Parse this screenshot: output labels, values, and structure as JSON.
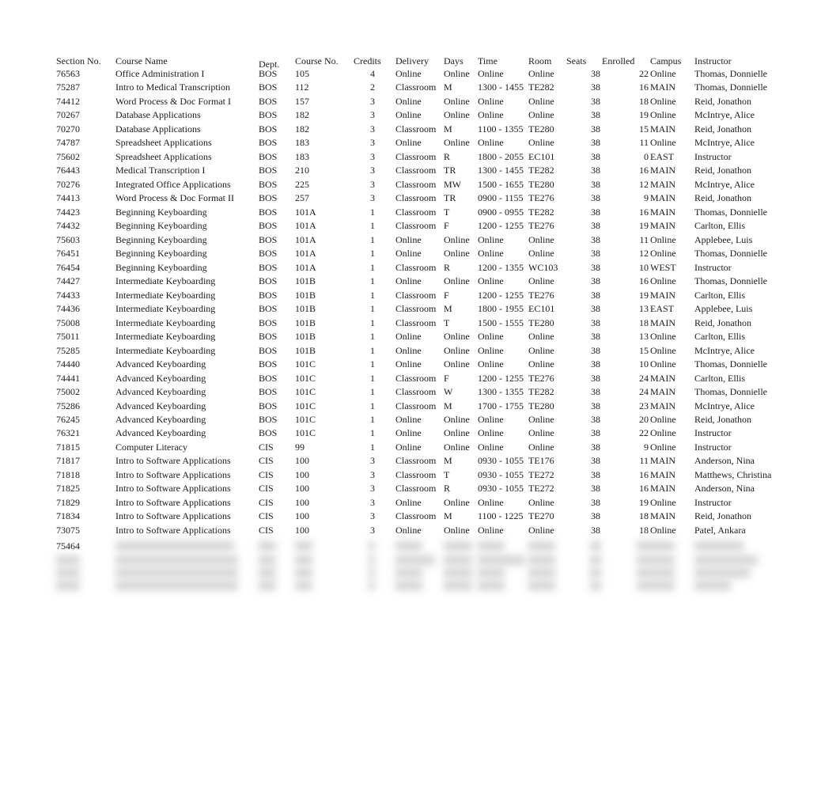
{
  "headers": {
    "section": "Section No.",
    "name": "Course Name",
    "dept": "Dept.",
    "course_no": "Course No.",
    "credits": "Credits",
    "delivery": "Delivery",
    "days": "Days",
    "time": "Time",
    "room": "Room",
    "seats": "Seats",
    "enrolled": "Enrolled",
    "campus": "Campus",
    "instructor": "Instructor"
  },
  "rows": [
    {
      "section": "76563",
      "name": "Office Administration I",
      "dept": "BOS",
      "course_no": "105",
      "credits": "4",
      "delivery": "Online",
      "days": "Online",
      "time": "Online",
      "room": "Online",
      "seats": "38",
      "enrolled": "22",
      "campus": "Online",
      "instructor": "Thomas, Donnielle"
    },
    {
      "section": "75287",
      "name": "Intro to Medical Transcription",
      "dept": "BOS",
      "course_no": "112",
      "credits": "2",
      "delivery": "Classroom",
      "days": "M",
      "time": "1300 - 1455",
      "room": "TE282",
      "seats": "38",
      "enrolled": "16",
      "campus": "MAIN",
      "instructor": "Thomas, Donnielle"
    },
    {
      "section": "74412",
      "name": "Word Process & Doc Format I",
      "dept": "BOS",
      "course_no": "157",
      "credits": "3",
      "delivery": "Online",
      "days": "Online",
      "time": "Online",
      "room": "Online",
      "seats": "38",
      "enrolled": "18",
      "campus": "Online",
      "instructor": "Reid, Jonathon"
    },
    {
      "section": "70267",
      "name": "Database Applications",
      "dept": "BOS",
      "course_no": "182",
      "credits": "3",
      "delivery": "Online",
      "days": "Online",
      "time": "Online",
      "room": "Online",
      "seats": "38",
      "enrolled": "19",
      "campus": "Online",
      "instructor": "McIntrye, Alice"
    },
    {
      "section": "70270",
      "name": "Database Applications",
      "dept": "BOS",
      "course_no": "182",
      "credits": "3",
      "delivery": "Classroom",
      "days": "M",
      "time": "1100 - 1355",
      "room": "TE280",
      "seats": "38",
      "enrolled": "15",
      "campus": "MAIN",
      "instructor": "Reid, Jonathon"
    },
    {
      "section": "74787",
      "name": "Spreadsheet Applications",
      "dept": "BOS",
      "course_no": "183",
      "credits": "3",
      "delivery": "Online",
      "days": "Online",
      "time": "Online",
      "room": "Online",
      "seats": "38",
      "enrolled": "11",
      "campus": "Online",
      "instructor": "McIntrye, Alice"
    },
    {
      "section": "75602",
      "name": "Spreadsheet Applications",
      "dept": "BOS",
      "course_no": "183",
      "credits": "3",
      "delivery": "Classroom",
      "days": "R",
      "time": "1800 - 2055",
      "room": "EC101",
      "seats": "38",
      "enrolled": "0",
      "campus": "EAST",
      "instructor": "Instructor"
    },
    {
      "section": "76443",
      "name": "Medical Transcription I",
      "dept": "BOS",
      "course_no": "210",
      "credits": "3",
      "delivery": "Classroom",
      "days": "TR",
      "time": "1300 - 1455",
      "room": "TE282",
      "seats": "38",
      "enrolled": "16",
      "campus": "MAIN",
      "instructor": "Reid, Jonathon"
    },
    {
      "section": "70276",
      "name": "Integrated Office Applications",
      "dept": "BOS",
      "course_no": "225",
      "credits": "3",
      "delivery": "Classroom",
      "days": "MW",
      "time": "1500 - 1655",
      "room": "TE280",
      "seats": "38",
      "enrolled": "12",
      "campus": "MAIN",
      "instructor": "McIntrye, Alice"
    },
    {
      "section": "74413",
      "name": "Word Process & Doc Format II",
      "dept": "BOS",
      "course_no": "257",
      "credits": "3",
      "delivery": "Classroom",
      "days": "TR",
      "time": "0900 - 1155",
      "room": "TE276",
      "seats": "38",
      "enrolled": "9",
      "campus": "MAIN",
      "instructor": "Reid, Jonathon"
    },
    {
      "section": "74423",
      "name": "Beginning Keyboarding",
      "dept": "BOS",
      "course_no": "101A",
      "credits": "1",
      "delivery": "Classroom",
      "days": "T",
      "time": "0900 - 0955",
      "room": "TE282",
      "seats": "38",
      "enrolled": "16",
      "campus": "MAIN",
      "instructor": "Thomas, Donnielle"
    },
    {
      "section": "74432",
      "name": "Beginning Keyboarding",
      "dept": "BOS",
      "course_no": "101A",
      "credits": "1",
      "delivery": "Classroom",
      "days": "F",
      "time": "1200 - 1255",
      "room": "TE276",
      "seats": "38",
      "enrolled": "19",
      "campus": "MAIN",
      "instructor": "Carlton, Ellis"
    },
    {
      "section": "75603",
      "name": "Beginning Keyboarding",
      "dept": "BOS",
      "course_no": "101A",
      "credits": "1",
      "delivery": "Online",
      "days": "Online",
      "time": "Online",
      "room": "Online",
      "seats": "38",
      "enrolled": "11",
      "campus": "Online",
      "instructor": "Applebee, Luis"
    },
    {
      "section": "76451",
      "name": "Beginning Keyboarding",
      "dept": "BOS",
      "course_no": "101A",
      "credits": "1",
      "delivery": "Online",
      "days": "Online",
      "time": "Online",
      "room": "Online",
      "seats": "38",
      "enrolled": "12",
      "campus": "Online",
      "instructor": "Thomas, Donnielle"
    },
    {
      "section": "76454",
      "name": "Beginning Keyboarding",
      "dept": "BOS",
      "course_no": "101A",
      "credits": "1",
      "delivery": "Classroom",
      "days": "R",
      "time": "1200 - 1355",
      "room": "WC103",
      "seats": "38",
      "enrolled": "10",
      "campus": "WEST",
      "instructor": "Instructor"
    },
    {
      "section": "74427",
      "name": "Intermediate Keyboarding",
      "dept": "BOS",
      "course_no": "101B",
      "credits": "1",
      "delivery": "Online",
      "days": "Online",
      "time": "Online",
      "room": "Online",
      "seats": "38",
      "enrolled": "16",
      "campus": "Online",
      "instructor": "Thomas, Donnielle"
    },
    {
      "section": "74433",
      "name": "Intermediate Keyboarding",
      "dept": "BOS",
      "course_no": "101B",
      "credits": "1",
      "delivery": "Classroom",
      "days": "F",
      "time": "1200 - 1255",
      "room": "TE276",
      "seats": "38",
      "enrolled": "19",
      "campus": "MAIN",
      "instructor": "Carlton, Ellis"
    },
    {
      "section": "74436",
      "name": "Intermediate Keyboarding",
      "dept": "BOS",
      "course_no": "101B",
      "credits": "1",
      "delivery": "Classroom",
      "days": "M",
      "time": "1800 - 1955",
      "room": "EC101",
      "seats": "38",
      "enrolled": "13",
      "campus": "EAST",
      "instructor": "Applebee, Luis"
    },
    {
      "section": "75008",
      "name": "Intermediate Keyboarding",
      "dept": "BOS",
      "course_no": "101B",
      "credits": "1",
      "delivery": "Classroom",
      "days": "T",
      "time": "1500 - 1555",
      "room": "TE280",
      "seats": "38",
      "enrolled": "18",
      "campus": "MAIN",
      "instructor": "Reid, Jonathon"
    },
    {
      "section": "75011",
      "name": "Intermediate Keyboarding",
      "dept": "BOS",
      "course_no": "101B",
      "credits": "1",
      "delivery": "Online",
      "days": "Online",
      "time": "Online",
      "room": "Online",
      "seats": "38",
      "enrolled": "13",
      "campus": "Online",
      "instructor": "Carlton, Ellis"
    },
    {
      "section": "75285",
      "name": "Intermediate Keyboarding",
      "dept": "BOS",
      "course_no": "101B",
      "credits": "1",
      "delivery": "Online",
      "days": "Online",
      "time": "Online",
      "room": "Online",
      "seats": "38",
      "enrolled": "15",
      "campus": "Online",
      "instructor": "McIntrye, Alice"
    },
    {
      "section": "74440",
      "name": "Advanced Keyboarding",
      "dept": "BOS",
      "course_no": "101C",
      "credits": "1",
      "delivery": "Online",
      "days": "Online",
      "time": "Online",
      "room": "Online",
      "seats": "38",
      "enrolled": "10",
      "campus": "Online",
      "instructor": "Thomas, Donnielle"
    },
    {
      "section": "74441",
      "name": "Advanced Keyboarding",
      "dept": "BOS",
      "course_no": "101C",
      "credits": "1",
      "delivery": "Classroom",
      "days": "F",
      "time": "1200 - 1255",
      "room": "TE276",
      "seats": "38",
      "enrolled": "24",
      "campus": "MAIN",
      "instructor": "Carlton, Ellis"
    },
    {
      "section": "75002",
      "name": "Advanced Keyboarding",
      "dept": "BOS",
      "course_no": "101C",
      "credits": "1",
      "delivery": "Classroom",
      "days": "W",
      "time": "1300 - 1355",
      "room": "TE282",
      "seats": "38",
      "enrolled": "24",
      "campus": "MAIN",
      "instructor": "Thomas, Donnielle"
    },
    {
      "section": "75286",
      "name": "Advanced Keyboarding",
      "dept": "BOS",
      "course_no": "101C",
      "credits": "1",
      "delivery": "Classroom",
      "days": "M",
      "time": "1700 - 1755",
      "room": "TE280",
      "seats": "38",
      "enrolled": "23",
      "campus": "MAIN",
      "instructor": "McIntrye, Alice"
    },
    {
      "section": "76245",
      "name": "Advanced Keyboarding",
      "dept": "BOS",
      "course_no": "101C",
      "credits": "1",
      "delivery": "Online",
      "days": "Online",
      "time": "Online",
      "room": "Online",
      "seats": "38",
      "enrolled": "20",
      "campus": "Online",
      "instructor": "Reid, Jonathon"
    },
    {
      "section": "76321",
      "name": "Advanced Keyboarding",
      "dept": "BOS",
      "course_no": "101C",
      "credits": "1",
      "delivery": "Online",
      "days": "Online",
      "time": "Online",
      "room": "Online",
      "seats": "38",
      "enrolled": "22",
      "campus": "Online",
      "instructor": "Instructor"
    },
    {
      "section": "71815",
      "name": "Computer Literacy",
      "dept": "CIS",
      "course_no": "99",
      "credits": "1",
      "delivery": "Online",
      "days": "Online",
      "time": "Online",
      "room": "Online",
      "seats": "38",
      "enrolled": "9",
      "campus": "Online",
      "instructor": "Instructor"
    },
    {
      "section": "71817",
      "name": "Intro to Software Applications",
      "dept": "CIS",
      "course_no": "100",
      "credits": "3",
      "delivery": "Classroom",
      "days": "M",
      "time": "0930 - 1055",
      "room": "TE176",
      "seats": "38",
      "enrolled": "11",
      "campus": "MAIN",
      "instructor": "Anderson, Nina"
    },
    {
      "section": "71818",
      "name": "Intro to Software Applications",
      "dept": "CIS",
      "course_no": "100",
      "credits": "3",
      "delivery": "Classroom",
      "days": "T",
      "time": "0930 - 1055",
      "room": "TE272",
      "seats": "38",
      "enrolled": "16",
      "campus": "MAIN",
      "instructor": "Matthews, Christina"
    },
    {
      "section": "71825",
      "name": "Intro to Software Applications",
      "dept": "CIS",
      "course_no": "100",
      "credits": "3",
      "delivery": "Classroom",
      "days": "R",
      "time": "0930 - 1055",
      "room": "TE272",
      "seats": "38",
      "enrolled": "16",
      "campus": "MAIN",
      "instructor": "Anderson, Nina"
    },
    {
      "section": "71829",
      "name": "Intro to Software Applications",
      "dept": "CIS",
      "course_no": "100",
      "credits": "3",
      "delivery": "Online",
      "days": "Online",
      "time": "Online",
      "room": "Online",
      "seats": "38",
      "enrolled": "19",
      "campus": "Online",
      "instructor": "Instructor"
    },
    {
      "section": "71834",
      "name": "Intro to Software Applications",
      "dept": "CIS",
      "course_no": "100",
      "credits": "3",
      "delivery": "Classroom",
      "days": "M",
      "time": "1100 - 1225",
      "room": "TE270",
      "seats": "38",
      "enrolled": "18",
      "campus": "MAIN",
      "instructor": "Reid, Jonathon"
    },
    {
      "section": "73075",
      "name": "Intro to Software Applications",
      "dept": "CIS",
      "course_no": "100",
      "credits": "3",
      "delivery": "Online",
      "days": "Online",
      "time": "Online",
      "room": "Online",
      "seats": "38",
      "enrolled": "18",
      "campus": "Online",
      "instructor": "Patel, Ankara"
    }
  ],
  "partial_row": {
    "section": "75464"
  }
}
